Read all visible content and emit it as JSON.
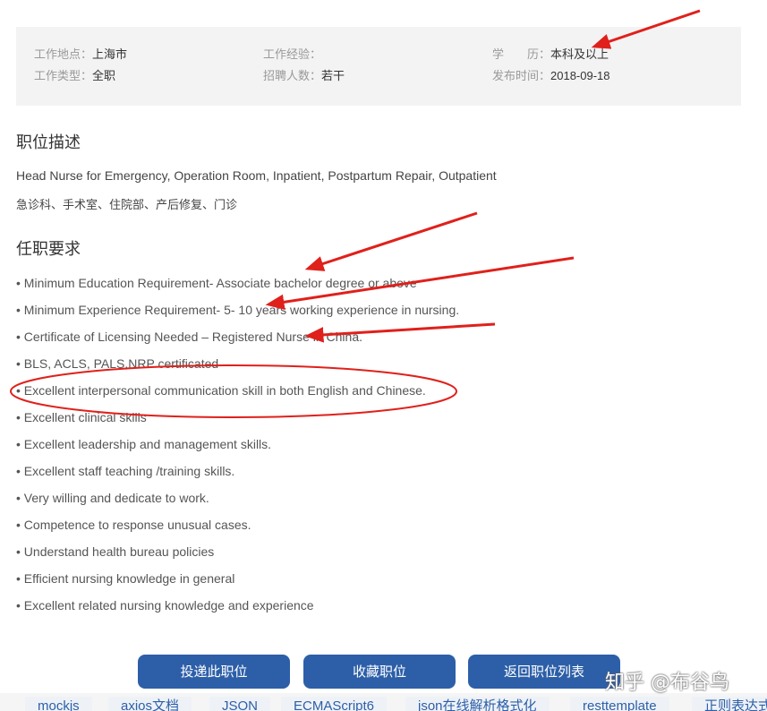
{
  "info": {
    "location_label": "工作地点：",
    "location_value": "上海市",
    "experience_label": "工作经验：",
    "experience_value": "",
    "education_label": "学　　历：",
    "education_value": "本科及以上",
    "type_label": "工作类型：",
    "type_value": "全职",
    "headcount_label": "招聘人数：",
    "headcount_value": "若干",
    "date_label": "发布时间：",
    "date_value": "2018-09-18"
  },
  "description": {
    "title": "职位描述",
    "line_en": "Head Nurse for Emergency, Operation Room, Inpatient, Postpartum Repair, Outpatient",
    "line_cn": "急诊科、手术室、住院部、产后修复、门诊"
  },
  "requirements": {
    "title": "任职要求",
    "items": [
      "• Minimum Education Requirement- Associate bachelor degree or above",
      "• Minimum Experience Requirement- 5- 10 years working experience in nursing.",
      "• Certificate of Licensing Needed – Registered Nurse in China.",
      "• BLS, ACLS, PALS,NRP certificated",
      "• Excellent interpersonal communication skill in both English and Chinese.",
      "• Excellent clinical skills",
      "• Excellent leadership and management skills.",
      "• Excellent staff teaching /training skills.",
      "• Very willing and dedicate to work.",
      "• Competence to response unusual cases.",
      "• Understand health bureau policies",
      "• Efficient nursing knowledge in general",
      "• Excellent related nursing knowledge and experience"
    ]
  },
  "actions": {
    "apply": "投递此职位",
    "favorite": "收藏职位",
    "back": "返回职位列表"
  },
  "tags": [
    "mockjs",
    "axios文档",
    "JSON",
    "ECMAScript6",
    "json在线解析格式化",
    "resttemplate",
    "正则表达式"
  ],
  "watermark": "知乎 @布谷鸟",
  "colors": {
    "button": "#2d5fa8",
    "annotation": "#e0201b",
    "info_bg": "#f3f3f3"
  }
}
